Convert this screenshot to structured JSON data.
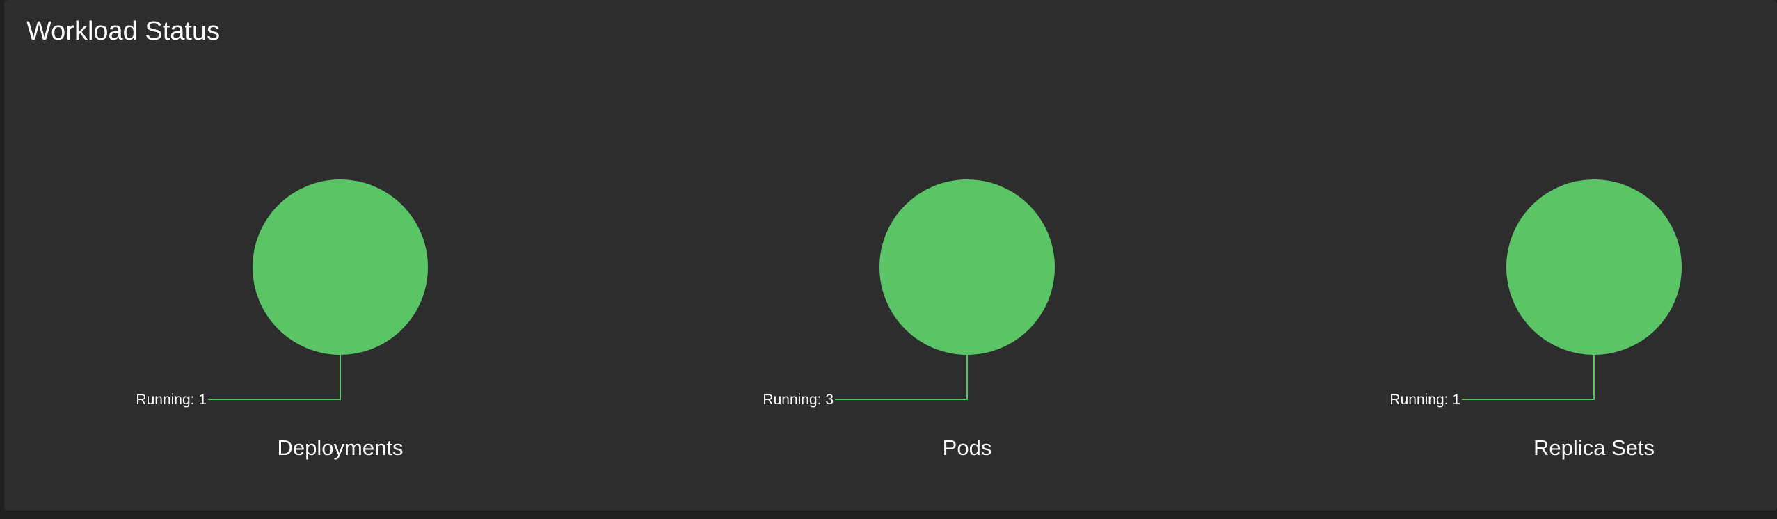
{
  "card": {
    "title": "Workload Status"
  },
  "colors": {
    "running": "#5ac466",
    "background": "#2d2d2d",
    "text": "#ffffff"
  },
  "chart_data": [
    {
      "type": "pie",
      "label": "Deployments",
      "slices": [
        {
          "status": "Running",
          "value": 1
        }
      ]
    },
    {
      "type": "pie",
      "label": "Pods",
      "slices": [
        {
          "status": "Running",
          "value": 3
        }
      ]
    },
    {
      "type": "pie",
      "label": "Replica Sets",
      "slices": [
        {
          "status": "Running",
          "value": 1
        }
      ]
    }
  ]
}
